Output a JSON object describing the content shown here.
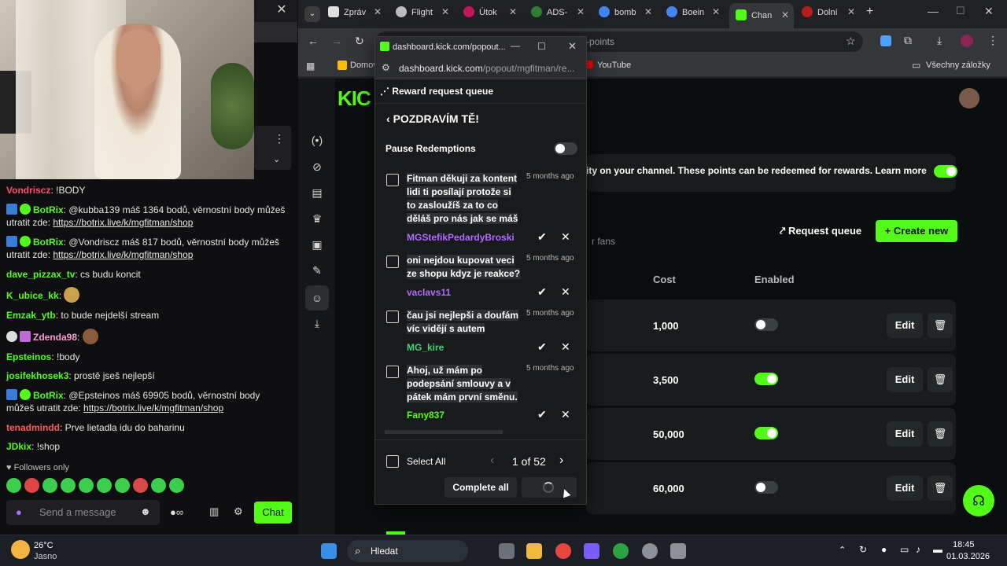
{
  "chat": {
    "messages": [
      {
        "user": "Vondriscz",
        "user_color": "#ff4d6d",
        "text": ": !BODY"
      },
      {
        "user": "BotRix",
        "user_color": "#53fc18",
        "text": ": @kubba139 máš 1364 bodů, věrnostní body můžeš utratit zde: ",
        "link": "https://botrix.live/k/mgfitman/shop"
      },
      {
        "user": "BotRix",
        "user_color": "#53fc18",
        "text": ": @Vondriscz máš 817 bodů, věrnostní body můžeš utratit zde: ",
        "link": "https://botrix.live/k/mgfitman/shop"
      },
      {
        "user": "dave_pizzax_tv",
        "user_color": "#53fc18",
        "text": ": cs budu koncit"
      },
      {
        "user": "K_ubice_kk",
        "user_color": "#53fc18",
        "text": ":"
      },
      {
        "user": "Emzak_ytb",
        "user_color": "#53fc18",
        "text": ": to bude nejdelší stream"
      },
      {
        "user": "Zdenda98",
        "user_color": "#ff9ad5",
        "text": ":"
      },
      {
        "user": "Epsteinos",
        "user_color": "#53fc18",
        "text": ": !body"
      },
      {
        "user": "josifekhosek3",
        "user_color": "#53fc18",
        "text": ": prostě jseš nejlepší"
      },
      {
        "user": "BotRix",
        "user_color": "#53fc18",
        "text": ": @Epsteinos máš 69905 bodů, věrnostní body můžeš utratit zde: ",
        "link": "https://botrix.live/k/mgfitman/shop"
      },
      {
        "user": "tenadmindd",
        "user_color": "#ff5a5a",
        "text": ": Prve lietadla idu do baharinu"
      },
      {
        "user": "JDkix",
        "user_color": "#53fc18",
        "text": ": !shop"
      }
    ],
    "followers_only": "Followers only",
    "placeholder": "Send a message",
    "chat_button": "Chat"
  },
  "browser": {
    "tabs": [
      {
        "label": "Zpráv",
        "color": "#e0e0e0"
      },
      {
        "label": "Flight",
        "color": "#bdbdbd"
      },
      {
        "label": "Útok",
        "color": "#c2185b"
      },
      {
        "label": "ADS-",
        "color": "#2e7d32"
      },
      {
        "label": "bomb",
        "color": "#4285f4"
      },
      {
        "label": "Boein",
        "color": "#4285f4"
      },
      {
        "label": "Chan",
        "color": "#53fc18"
      },
      {
        "label": "Dolní",
        "color": "#b71c1c"
      }
    ],
    "url_fragment": "-points",
    "bookmarks": [
      {
        "label": "Domov"
      },
      {
        "label": "YouTube"
      },
      {
        "label": "Všechny záložky"
      }
    ]
  },
  "kick_page": {
    "points_notice": "ity on your channel. These points can be redeemed for rewards. Learn more",
    "fans_fragment": "r fans",
    "request_queue_button": "Request queue",
    "create_new_button": "Create new",
    "col_cost": "Cost",
    "col_enabled": "Enabled",
    "rows": [
      {
        "cost": "1,000",
        "enabled": false,
        "edit": "Edit"
      },
      {
        "cost": "3,500",
        "enabled": true,
        "edit": "Edit"
      },
      {
        "cost": "50,000",
        "enabled": true,
        "edit": "Edit"
      },
      {
        "cost": "60,000",
        "enabled": false,
        "edit": "Edit"
      }
    ]
  },
  "popup": {
    "window_title": "dashboard.kick.com/popout...",
    "url": "dashboard.kick.com",
    "url_rest": "/popout/mgfitman/re...",
    "heading": "Reward request queue",
    "reward_title": "POZDRAVÍM TĚ!",
    "pause_label": "Pause Redemptions",
    "pause_on": false,
    "requests": [
      {
        "text": "Fitman děkuji za kontent lidi ti posílají protože si to zasloužíš za to co děláš pro nás jak se máš",
        "time": "5 months ago",
        "user": "MGStefikPedardyBroski",
        "user_color": "#b06cff"
      },
      {
        "text": "oni nejdou kupovat veci ze shopu kdyz je reakce?",
        "time": "5 months ago",
        "user": "vaclavs11",
        "user_color": "#b06cff"
      },
      {
        "text": "čau jsi nejlepši a doufám víc vidějí s autem",
        "time": "5 months ago",
        "user": "MG_kire",
        "user_color": "#45d07a"
      },
      {
        "text": "Ahoj, už mám po podepsání smlouvy a v pátek mám první směnu.",
        "time": "5 months ago",
        "user": "Fany837",
        "user_color": "#53fc18"
      }
    ],
    "select_all": "Select All",
    "pagination": "1 of 52",
    "complete_all": "Complete all"
  },
  "taskbar": {
    "temp": "26°C",
    "weather": "Jasno",
    "search": "Hledat",
    "time": "18:45",
    "date": "01.03.2026"
  }
}
